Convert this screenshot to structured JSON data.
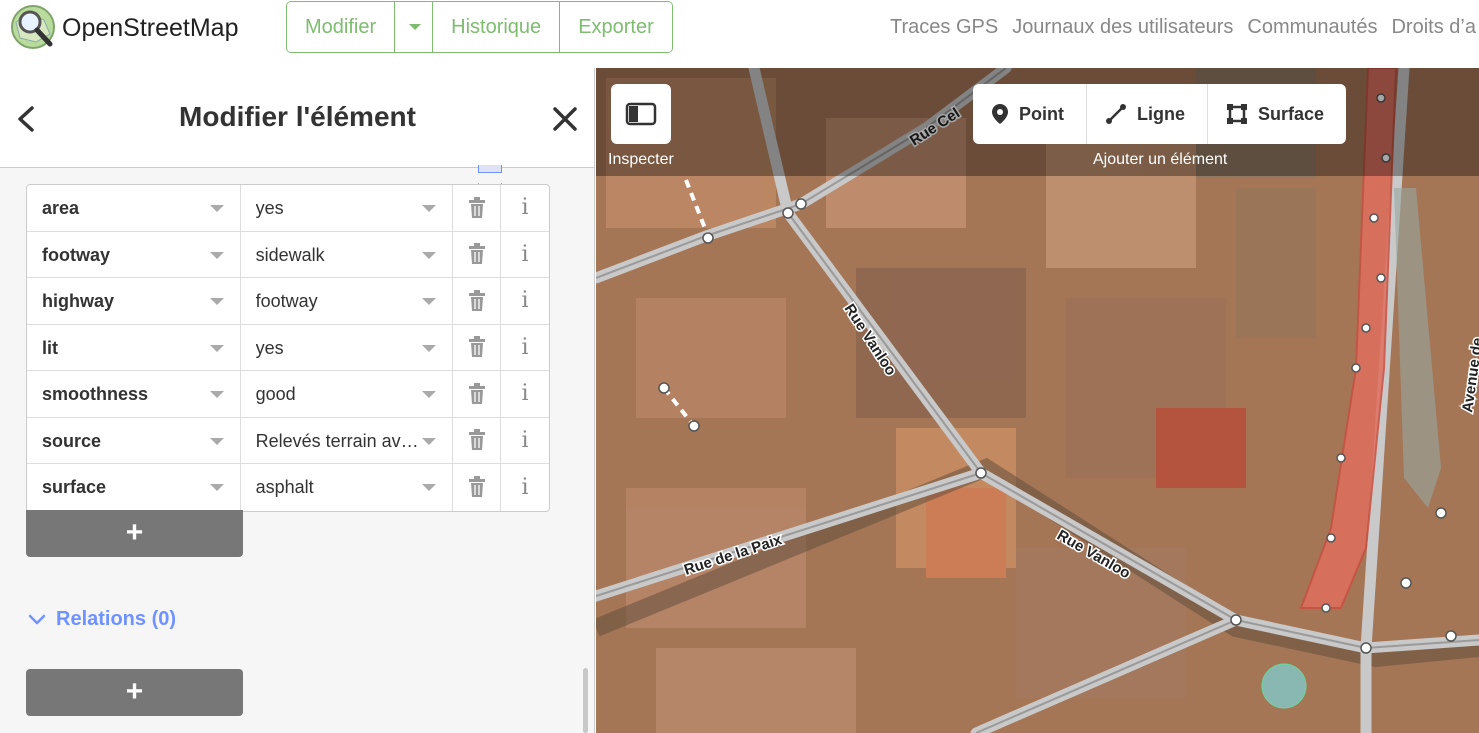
{
  "navbar": {
    "brand": "OpenStreetMap",
    "edit": "Modifier",
    "history": "Historique",
    "export": "Exporter",
    "links": [
      "Traces GPS",
      "Journaux des utilisateurs",
      "Communautés",
      "Droits d’a"
    ]
  },
  "sidebar": {
    "title": "Modifier l'élément",
    "tags": [
      {
        "key": "area",
        "value": "yes"
      },
      {
        "key": "footway",
        "value": "sidewalk"
      },
      {
        "key": "highway",
        "value": "footway"
      },
      {
        "key": "lit",
        "value": "yes"
      },
      {
        "key": "smoothness",
        "value": "good"
      },
      {
        "key": "source",
        "value": "Relevés terrain avec..."
      },
      {
        "key": "surface",
        "value": "asphalt"
      }
    ],
    "add_label": "+",
    "relations_label": "Relations (0)",
    "add_relation_label": "+"
  },
  "map": {
    "inspect_label": "Inspecter",
    "add_point": "Point",
    "add_line": "Ligne",
    "add_area": "Surface",
    "add_feature_label": "Ajouter un élément",
    "street_labels": [
      "Rue Cel",
      "Rue Vanloo",
      "Rue de la Paix",
      "Rue Vanloo",
      "Avenue de"
    ]
  },
  "colors": {
    "osm_green": "#7ebc6f",
    "relations_blue": "#7092ff",
    "selected_red": "#e06e5f"
  }
}
